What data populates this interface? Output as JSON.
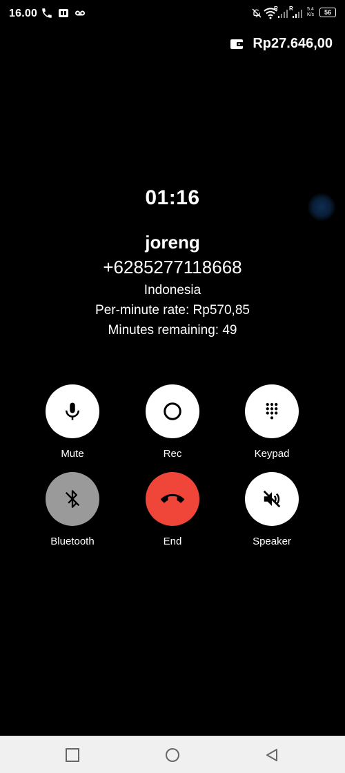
{
  "status_bar": {
    "time": "16.00",
    "net_speed_top": "5.4",
    "net_speed_bottom": "K/s",
    "battery": "56",
    "signal_badge": "R"
  },
  "wallet": {
    "balance": "Rp27.646,00"
  },
  "call": {
    "timer": "01:16",
    "contact_name": "joreng",
    "phone_number": "+6285277118668",
    "country": "Indonesia",
    "rate": "Per-minute rate: Rp570,85",
    "minutes_remaining": "Minutes remaining: 49"
  },
  "controls": {
    "mute": "Mute",
    "rec": "Rec",
    "keypad": "Keypad",
    "bluetooth": "Bluetooth",
    "end": "End",
    "speaker": "Speaker"
  },
  "colors": {
    "end_call": "#f0463a",
    "disabled_button": "#9a9a9a",
    "background": "#000000"
  }
}
